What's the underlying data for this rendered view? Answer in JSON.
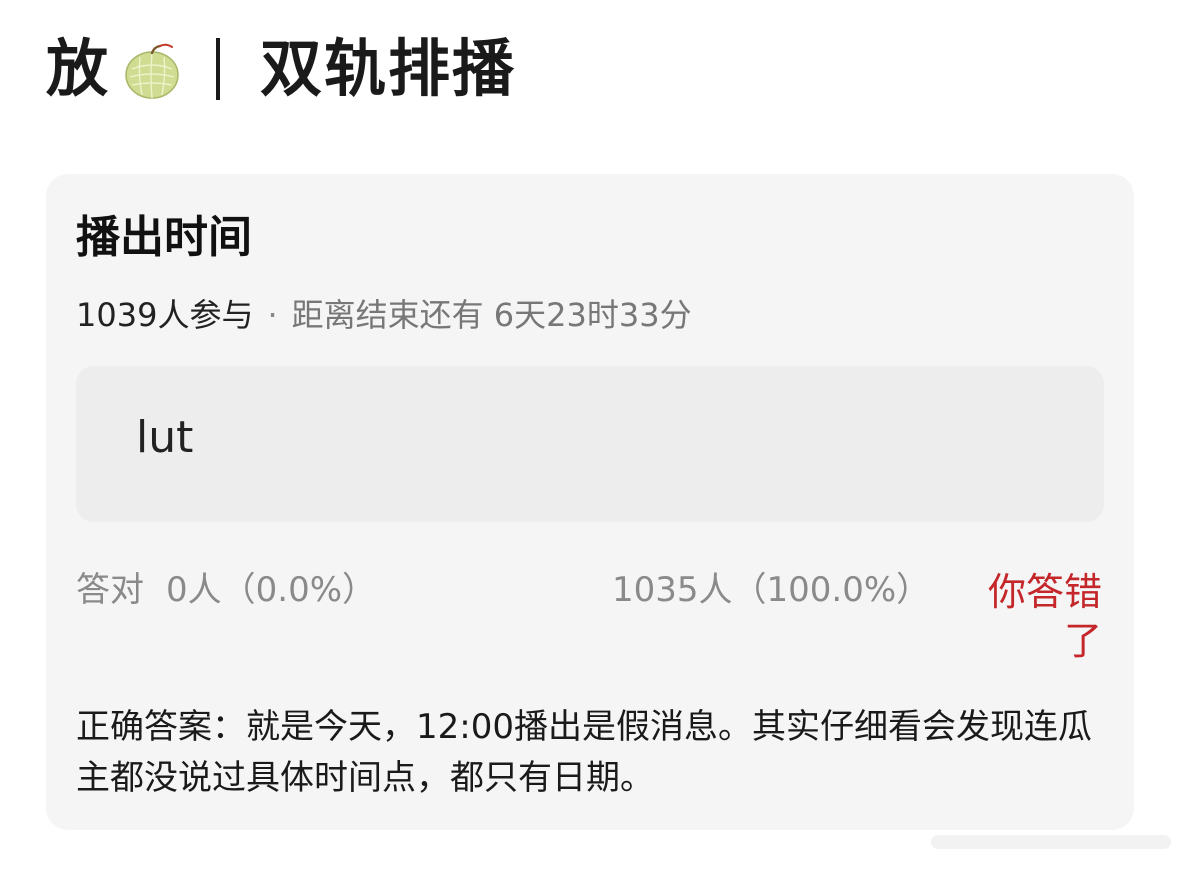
{
  "header": {
    "prefix": "放",
    "icon": "melon-emoji",
    "title": "双轨排播"
  },
  "poll": {
    "title": "播出时间",
    "participants": "1039人参与",
    "separator": "·",
    "time_left": "距离结束还有 6天23时33分",
    "option": {
      "label": "lut"
    },
    "result": {
      "correct_label": "答对",
      "correct_value": "0人（0.0%）",
      "other_value": "1035人（100.0%）",
      "status": "你答错了"
    },
    "answer_text": "正确答案：就是今天，12:00播出是假消息。其实仔细看会发现连瓜主都没说过具体时间点，都只有日期。"
  },
  "colors": {
    "card_bg": "#f5f5f5",
    "option_bg": "#ededed",
    "muted_text": "#8a8a8a",
    "wrong_red": "#c4262a",
    "melon_green": "#c9d98a"
  }
}
